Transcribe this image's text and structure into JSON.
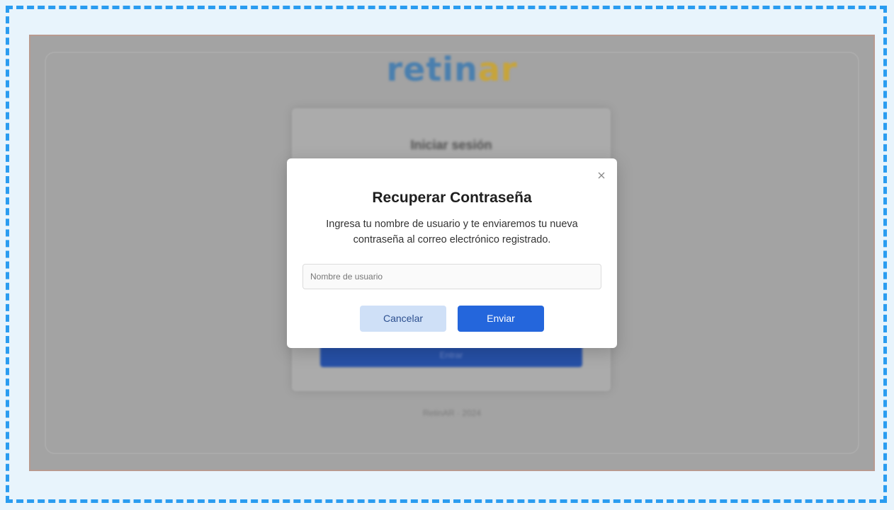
{
  "background_page": {
    "logo": {
      "part1": "retin",
      "part2": "ar"
    },
    "card_title": "Iniciar sesión",
    "primary_button_label": "Entrar",
    "footer_text": "RetinAR · 2024"
  },
  "modal": {
    "title": "Recuperar Contraseña",
    "description": "Ingresa tu nombre de usuario y te enviaremos tu nueva contraseña al correo electrónico registrado.",
    "username_placeholder": "Nombre de usuario",
    "username_value": "",
    "cancel_label": "Cancelar",
    "send_label": "Enviar",
    "close_icon": "close-icon"
  },
  "colors": {
    "frame_dash": "#2a9cf0",
    "primary": "#2466dc",
    "secondary": "#cfe0f7",
    "logo_blue": "#4a7fae",
    "logo_gold": "#c7a43a"
  }
}
